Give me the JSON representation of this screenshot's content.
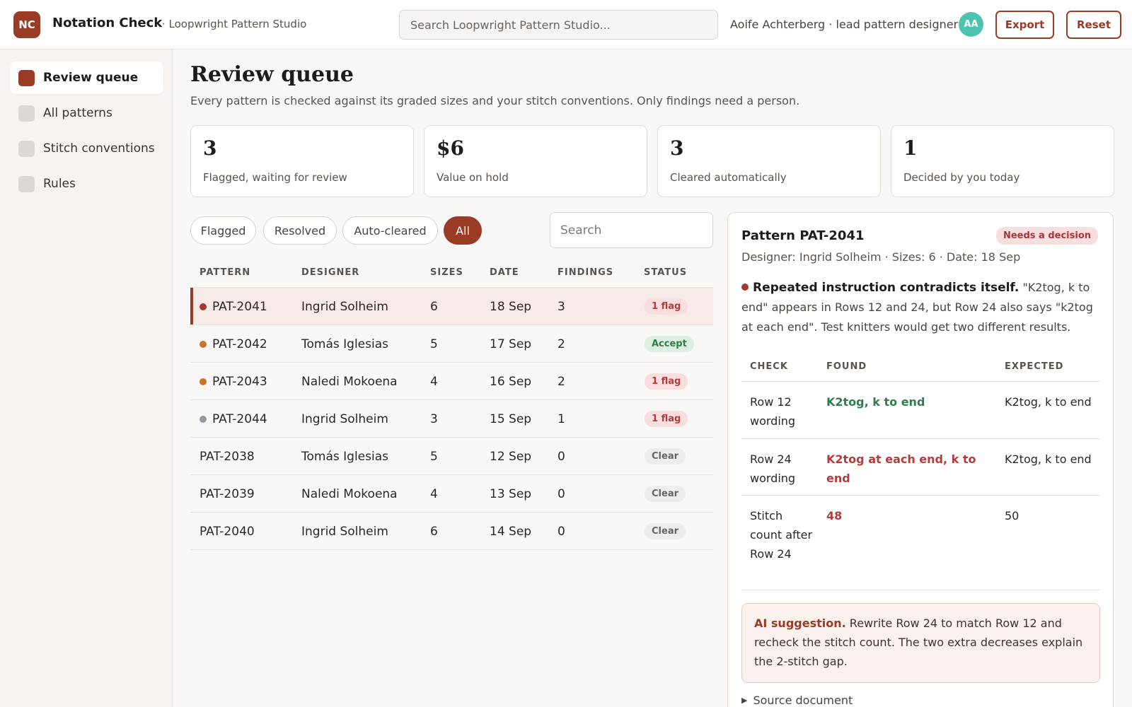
{
  "header": {
    "logo": "NC",
    "app_title": "Notation Check",
    "workspace": "· Loopwright Pattern Studio",
    "search_placeholder": "Search Loopwright Pattern Studio...",
    "user": "Aoife Achterberg · lead pattern designer",
    "avatar": "AA",
    "export_label": "Export",
    "reset_label": "Reset"
  },
  "sidebar": {
    "items": [
      {
        "label": "Review queue",
        "active": true
      },
      {
        "label": "All patterns",
        "active": false
      },
      {
        "label": "Stitch conventions",
        "active": false
      },
      {
        "label": "Rules",
        "active": false
      }
    ]
  },
  "main": {
    "title": "Review queue",
    "subtitle": "Every pattern is checked against its graded sizes and your stitch conventions. Only findings need a person.",
    "stats": [
      {
        "value": "3",
        "label": "Flagged, waiting for review"
      },
      {
        "value": "$6",
        "label": "Value on hold"
      },
      {
        "value": "3",
        "label": "Cleared automatically"
      },
      {
        "value": "1",
        "label": "Decided by you today"
      }
    ],
    "filters": [
      "Flagged",
      "Resolved",
      "Auto-cleared",
      "All"
    ],
    "active_filter": "All",
    "search_placeholder": "Search"
  },
  "table": {
    "columns": [
      "PATTERN",
      "DESIGNER",
      "SIZES",
      "DATE",
      "FINDINGS",
      "STATUS"
    ],
    "rows": [
      {
        "pattern": "PAT-2041",
        "designer": "Ingrid Solheim",
        "sizes": "6",
        "date": "18 Sep",
        "findings": "3",
        "status": "1 flag",
        "kind": "flag",
        "dot": "#a63636",
        "selected": true
      },
      {
        "pattern": "PAT-2042",
        "designer": "Tomás Iglesias",
        "sizes": "5",
        "date": "17 Sep",
        "findings": "2",
        "status": "Accept",
        "kind": "accept",
        "dot": "#c8742a",
        "selected": false
      },
      {
        "pattern": "PAT-2043",
        "designer": "Naledi Mokoena",
        "sizes": "4",
        "date": "16 Sep",
        "findings": "2",
        "status": "1 flag",
        "kind": "flag",
        "dot": "#c8742a",
        "selected": false
      },
      {
        "pattern": "PAT-2044",
        "designer": "Ingrid Solheim",
        "sizes": "3",
        "date": "15 Sep",
        "findings": "1",
        "status": "1 flag",
        "kind": "flag",
        "dot": "#9a96a0",
        "selected": false
      },
      {
        "pattern": "PAT-2038",
        "designer": "Tomás Iglesias",
        "sizes": "5",
        "date": "12 Sep",
        "findings": "0",
        "status": "Clear",
        "kind": "clear",
        "dot": "",
        "selected": false
      },
      {
        "pattern": "PAT-2039",
        "designer": "Naledi Mokoena",
        "sizes": "4",
        "date": "13 Sep",
        "findings": "0",
        "status": "Clear",
        "kind": "clear",
        "dot": "",
        "selected": false
      },
      {
        "pattern": "PAT-2040",
        "designer": "Ingrid Solheim",
        "sizes": "6",
        "date": "14 Sep",
        "findings": "0",
        "status": "Clear",
        "kind": "clear",
        "dot": "",
        "selected": false
      }
    ]
  },
  "detail": {
    "title": "Pattern PAT-2041",
    "badge": "Needs a decision",
    "meta": "Designer: Ingrid Solheim · Sizes: 6 · Date: 18 Sep",
    "finding_title": "Repeated instruction contradicts itself.",
    "finding_text": "\"K2tog, k to end\" appears in Rows 12 and 24, but Row 24 also says \"k2tog at each end\". Test knitters would get two different results.",
    "check_columns": [
      "CHECK",
      "FOUND",
      "EXPECTED"
    ],
    "checks": [
      {
        "check": "Row 12 wording",
        "found": "K2tog, k to end",
        "expected": "K2tog, k to end",
        "ok": true
      },
      {
        "check": "Row 24 wording",
        "found": "K2tog at each end, k to end",
        "expected": "K2tog, k to end",
        "ok": false
      },
      {
        "check": "Stitch count after Row 24",
        "found": "48",
        "expected": "50",
        "ok": false
      }
    ],
    "ai_label": "AI suggestion.",
    "ai_text": "Rewrite Row 24 to match Row 12 and recheck the stitch count. The two extra decreases explain the 2-stitch gap.",
    "source_label": "Source document"
  },
  "colors": {
    "accent": "#9a3b26",
    "flag_badge_bg": "#f8dede",
    "flag_badge_fg": "#b23b3b",
    "accept_badge_bg": "#dcf0e2",
    "accept_badge_fg": "#2f7d4a",
    "clear_badge_bg": "#efedeb",
    "clear_badge_fg": "#6b635e"
  }
}
